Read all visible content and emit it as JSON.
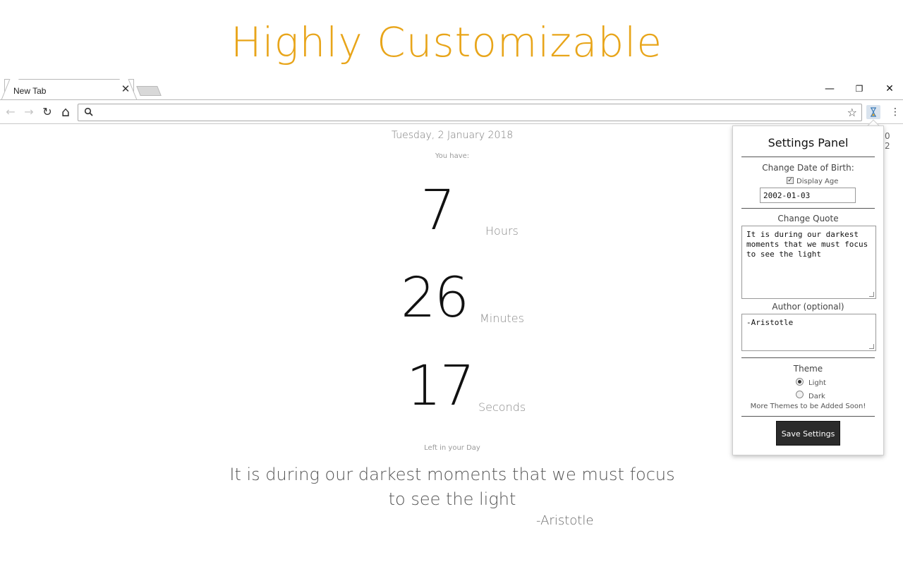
{
  "hero": {
    "title": "Highly Customizable"
  },
  "browser": {
    "tab_title": "New Tab",
    "tab_close": "✕",
    "window_controls": {
      "minimize": "—",
      "restore": "❐",
      "close": "✕"
    },
    "icons": {
      "back": "arrow-left-icon",
      "forward": "arrow-right-icon",
      "reload": "reload-icon",
      "home": "home-icon",
      "search": "search-icon",
      "star": "star-icon",
      "extension": "extension-icon",
      "menu": "kebab-menu-icon"
    },
    "glyphs": {
      "back": "←",
      "forward": "→",
      "reload": "↻",
      "home": "⌂",
      "star": "☆",
      "menu": "⋮"
    }
  },
  "page": {
    "date": "Tuesday, 2 January 2018",
    "you_have": "You have:",
    "hours": {
      "value": "7",
      "unit": "Hours"
    },
    "minutes": {
      "value": "26",
      "unit": "Minutes"
    },
    "seconds": {
      "value": "17",
      "unit": "Seconds"
    },
    "left_in_day": "Left in your Day",
    "quote": "It is during our darkest moments that we must focus to see the light",
    "author": "-Aristotle",
    "side_digits": "0 2"
  },
  "settings": {
    "title": "Settings Panel",
    "dob_label": "Change Date of Birth:",
    "display_age_label": "Display Age",
    "display_age_checked": true,
    "dob_value": "2002-01-03",
    "quote_label": "Change Quote",
    "quote_value": "It is during our darkest moments that we must focus to see the light",
    "author_label": "Author (optional)",
    "author_value": "-Aristotle",
    "theme_label": "Theme",
    "theme_options": [
      "Light",
      "Dark"
    ],
    "theme_selected": "Light",
    "more_themes": "More Themes to be Added Soon!",
    "save_label": "Save Settings"
  },
  "colors": {
    "accent": "#e8a51a",
    "save_button_bg": "#2b2b2b"
  }
}
